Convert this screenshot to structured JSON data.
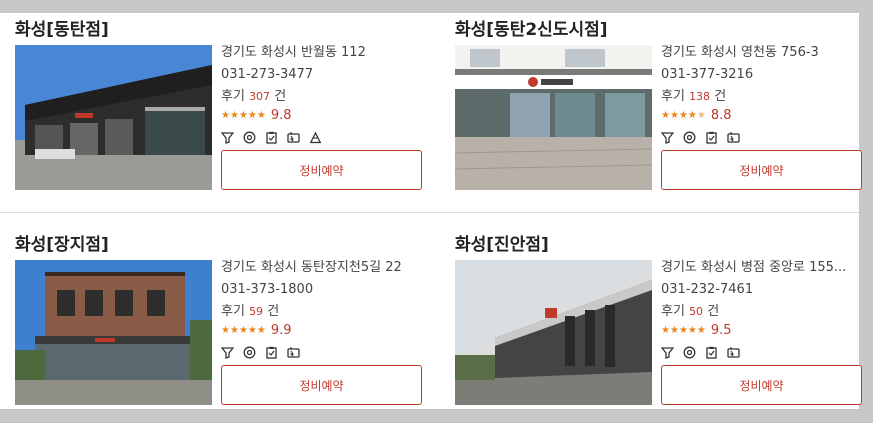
{
  "stores": [
    {
      "name": "화성[동탄점]",
      "address": "경기도 화성시 반월동 112",
      "phone": "031-273-3477",
      "reviews_label": "후기",
      "reviews_count": "307",
      "reviews_unit": "건",
      "rating_stars": 5,
      "score": "9.8",
      "services": [
        "wash-icon",
        "tire-icon",
        "checklist-icon",
        "battery-icon",
        "alignment-icon"
      ],
      "button_label": "정비예약"
    },
    {
      "name": "화성[동탄2신도시점]",
      "address": "경기도 화성시 영천동 756-3",
      "phone": "031-377-3216",
      "reviews_label": "후기",
      "reviews_count": "138",
      "reviews_unit": "건",
      "rating_stars": 4.5,
      "score": "8.8",
      "services": [
        "wash-icon",
        "tire-icon",
        "checklist-icon",
        "battery-icon"
      ],
      "button_label": "정비예약"
    },
    {
      "name": "화성[장지점]",
      "address": "경기도 화성시 동탄장지천5길 22",
      "phone": "031-373-1800",
      "reviews_label": "후기",
      "reviews_count": "59",
      "reviews_unit": "건",
      "rating_stars": 5,
      "score": "9.9",
      "services": [
        "wash-icon",
        "tire-icon",
        "checklist-icon",
        "battery-icon"
      ],
      "button_label": "정비예약"
    },
    {
      "name": "화성[진안점]",
      "address": "경기도 화성시 병점 중앙로 155...",
      "phone": "031-232-7461",
      "reviews_label": "후기",
      "reviews_count": "50",
      "reviews_unit": "건",
      "rating_stars": 5,
      "score": "9.5",
      "services": [
        "wash-icon",
        "tire-icon",
        "checklist-icon",
        "battery-icon"
      ],
      "button_label": "정비예약"
    }
  ],
  "colors": {
    "accent": "#c0392b",
    "star": "#e8861c"
  }
}
